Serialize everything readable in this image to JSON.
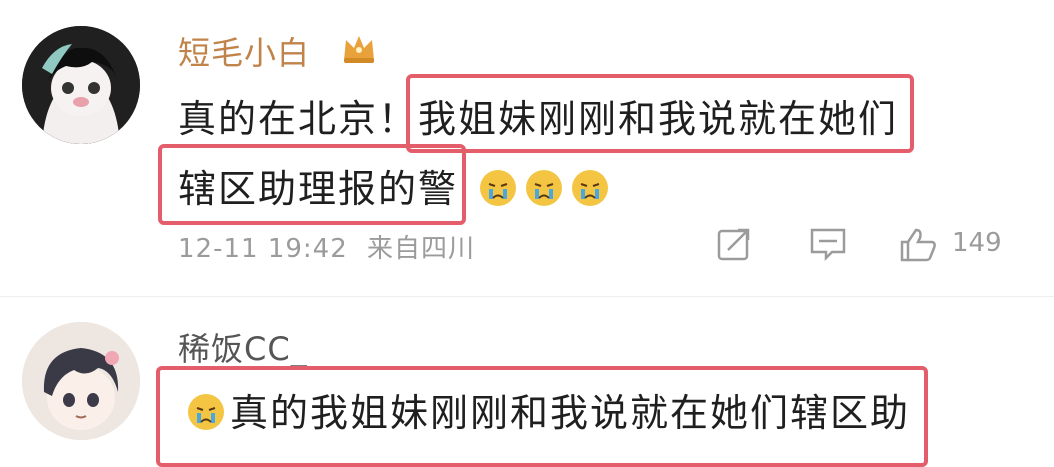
{
  "comments": [
    {
      "username": "短毛小白",
      "badge_icon": "crown-icon",
      "text_line1_before": "真的在北京！",
      "text_line1_highlight": "我姐妹刚刚和我说就在她们",
      "text_line2_highlight": "辖区助理报的警",
      "reaction_icon": "crying-emoji-icon",
      "reaction_count_shown": 3,
      "timestamp": "12-11 19:42",
      "source": "来自四川",
      "like_count": "149"
    },
    {
      "username": "稀饭CC_",
      "text_highlight": "真的我姐妹刚刚和我说就在她们辖区助",
      "leading_icon": "crying-emoji-icon"
    }
  ],
  "colors": {
    "highlight_box": "#e35d6a",
    "username_vip": "#c0834a",
    "meta_gray": "#9b9b9b"
  }
}
